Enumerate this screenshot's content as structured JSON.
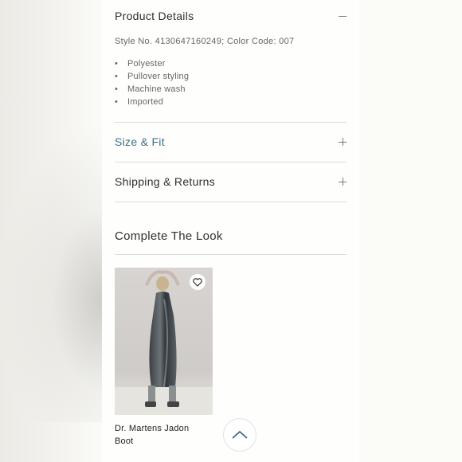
{
  "product_details": {
    "title": "Product Details",
    "toggle": "collapse",
    "style_line": "Style No. 4130647160249; Color Code: 007",
    "features": [
      "Polyester",
      "Pullover styling",
      "Machine wash",
      "Imported"
    ]
  },
  "size_fit": {
    "title": "Size & Fit",
    "toggle": "expand"
  },
  "shipping": {
    "title": "Shipping & Returns",
    "toggle": "expand"
  },
  "complete_look": {
    "title": "Complete The Look",
    "items": [
      {
        "name": "Dr. Martens Jadon Boot",
        "wishlist_icon": "heart-icon"
      }
    ]
  },
  "scroll_top": {
    "icon": "chevron-up-icon"
  },
  "colors": {
    "accent": "#3b6e86",
    "text": "#2f2f2f",
    "muted": "#666666",
    "divider": "#dcdcd8"
  }
}
